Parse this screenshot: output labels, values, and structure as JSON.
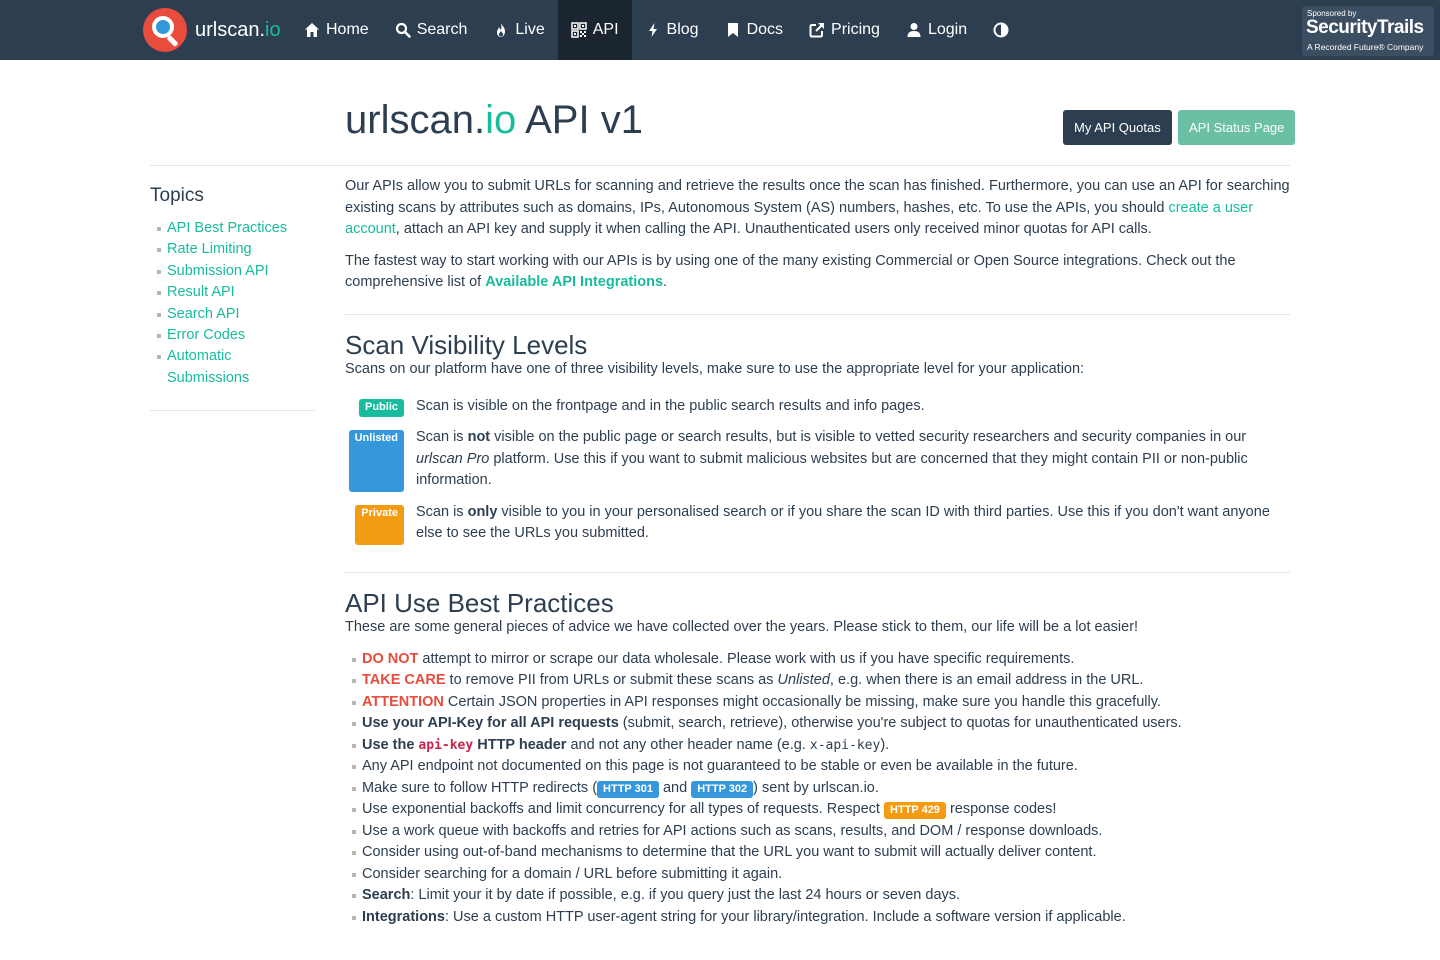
{
  "navbar": {
    "brand": {
      "name": "urlscan.",
      "tld": "io"
    },
    "items": [
      {
        "label": "Home",
        "icon": "home-icon"
      },
      {
        "label": "Search",
        "icon": "search-icon"
      },
      {
        "label": "Live",
        "icon": "fire-icon"
      },
      {
        "label": "API",
        "icon": "qrcode-icon",
        "active": true
      },
      {
        "label": "Blog",
        "icon": "bolt-icon"
      },
      {
        "label": "Docs",
        "icon": "bookmark-icon"
      },
      {
        "label": "Pricing",
        "icon": "external-link-icon"
      },
      {
        "label": "Login",
        "icon": "user-icon"
      }
    ],
    "theme_toggle_icon": "contrast-icon",
    "sponsor": {
      "line1": "Sponsored by",
      "line2": "SecurityTrails",
      "line3": "A Recorded Future® Company"
    }
  },
  "header": {
    "title_a": "urlscan.",
    "title_io": "io",
    "title_b": " API v1",
    "btn_quotas": "My API Quotas",
    "btn_status": "API Status Page"
  },
  "sidebar": {
    "title": "Topics",
    "items": [
      "API Best Practices",
      "Rate Limiting",
      "Submission API",
      "Result API",
      "Search API",
      "Error Codes",
      "Automatic Submissions"
    ]
  },
  "intro": {
    "p1_a": "Our APIs allow you to submit URLs for scanning and retrieve the results once the scan has finished. Furthermore, you can use an API for searching existing scans by attributes such as domains, IPs, Autonomous System (AS) numbers, hashes, etc. To use the APIs, you should ",
    "p1_link": "create a user account",
    "p1_b": ", attach an API key and supply it when calling the API. Unauthenticated users only received minor quotas for API calls.",
    "p2_a": "The fastest way to start working with our APIs is by using one of the many existing Commercial or Open Source integrations. Check out the comprehensive list of ",
    "p2_link": "Available API Integrations",
    "p2_b": "."
  },
  "visibility": {
    "title": "Scan Visibility Levels",
    "intro": "Scans on our platform have one of three visibility levels, make sure to use the appropriate level for your application:",
    "public": {
      "badge": "Public",
      "text": "Scan is visible on the frontpage and in the public search results and info pages."
    },
    "unlisted": {
      "badge": "Unlisted",
      "t1": "Scan is ",
      "bold": "not",
      "t2": " visible on the public page or search results, but is visible to vetted security researchers and security companies in our ",
      "em": "urlscan Pro",
      "t3": " platform. Use this if you want to submit malicious websites but are concerned that they might contain PII or non-public information."
    },
    "private": {
      "badge": "Private",
      "t1": "Scan is ",
      "bold": "only",
      "t2": " visible to you in your personalised search or if you share the scan ID with third parties. Use this if you don't want anyone else to see the URLs you submitted."
    }
  },
  "best": {
    "title": "API Use Best Practices",
    "intro": "These are some general pieces of advice we have collected over the years. Please stick to them, our life will be a lot easier!",
    "i1_red": "DO NOT",
    "i1": " attempt to mirror or scrape our data wholesale. Please work with us if you have specific requirements.",
    "i2_red": "TAKE CARE",
    "i2_a": " to remove PII from URLs or submit these scans as ",
    "i2_em": "Unlisted",
    "i2_b": ", e.g. when there is an email address in the URL.",
    "i3_red": "ATTENTION",
    "i3": " Certain JSON properties in API responses might occasionally be missing, make sure you handle this gracefully.",
    "i4_bold": "Use your API-Key for all API requests",
    "i4": " (submit, search, retrieve), otherwise you're subject to quotas for unauthenticated users.",
    "i5_bold_a": "Use the ",
    "i5_code": "api-key",
    "i5_bold_b": " HTTP header",
    "i5_a": " and not any other header name (e.g. ",
    "i5_code2": "x-api-key",
    "i5_b": ").",
    "i6": "Any API endpoint not documented on this page is not guaranteed to be stable or even be available in the future.",
    "i7_a": "Make sure to follow HTTP redirects (",
    "i7_badge1": "HTTP 301",
    "i7_b": " and ",
    "i7_badge2": "HTTP 302",
    "i7_c": ") sent by urlscan.io.",
    "i8_a": "Use exponential backoffs and limit concurrency for all types of requests. Respect ",
    "i8_badge": "HTTP 429",
    "i8_b": " response codes!",
    "i9": "Use a work queue with backoffs and retries for API actions such as scans, results, and DOM / response downloads.",
    "i10": "Consider using out-of-band mechanisms to determine that the URL you want to submit will actually deliver content.",
    "i11": "Consider searching for a domain / URL before submitting it again.",
    "i12_bold": "Search",
    "i12": ": Limit your it by date if possible, e.g. if you query just the last 24 hours or seven days.",
    "i13_bold": "Integrations",
    "i13": ": Use a custom HTTP user-agent string for your library/integration. Include a software version if applicable."
  },
  "colors": {
    "navbar": "#2c3e50",
    "accent": "#18bc9c",
    "danger": "#e74c3c",
    "info": "#3498db",
    "warning": "#f39c12"
  }
}
